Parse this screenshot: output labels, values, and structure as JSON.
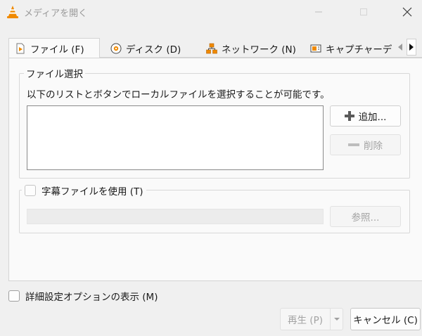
{
  "window": {
    "title": "メディアを開く",
    "icon": "vlc-cone-icon",
    "controls": [
      "minimize-icon",
      "maximize-icon",
      "close-icon"
    ]
  },
  "tabs": [
    {
      "label": "ファイル (F)",
      "icon": "file-play-icon",
      "active": true
    },
    {
      "label": "ディスク (D)",
      "icon": "disc-icon",
      "active": false
    },
    {
      "label": "ネットワーク (N)",
      "icon": "network-icon",
      "active": false
    },
    {
      "label": "キャプチャーデ",
      "icon": "capture-device-icon",
      "active": false
    }
  ],
  "file_selection": {
    "legend": "ファイル選択",
    "instruction": "以下のリストとボタンでローカルファイルを選択することが可能です。",
    "add_label": "追加...",
    "remove_label": "削除"
  },
  "subtitles": {
    "checkbox_label": "字幕ファイルを使用 (T)",
    "checked": false,
    "browse_label": "参照..."
  },
  "advanced": {
    "checkbox_label": "詳細設定オプションの表示 (M)",
    "checked": false
  },
  "actions": {
    "play_label": "再生 (P)",
    "cancel_label": "キャンセル (C)"
  },
  "colors": {
    "vlc_orange": "#f08a00",
    "background": "#f0f0f0",
    "panel": "#fafafa",
    "disabled_text": "#a3a3a3"
  }
}
